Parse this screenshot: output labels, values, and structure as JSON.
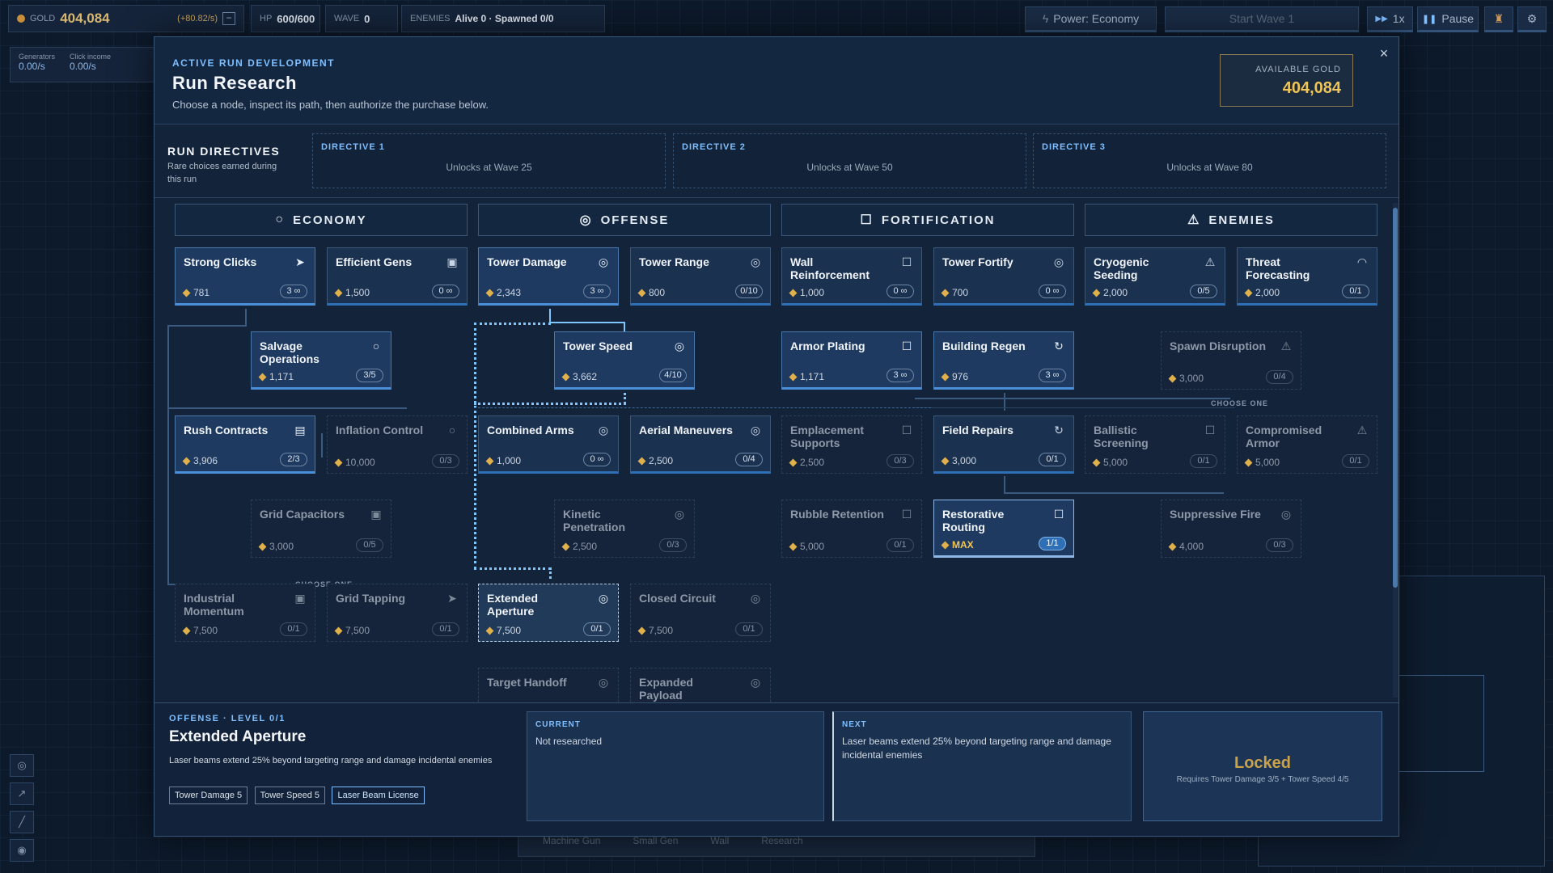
{
  "hud": {
    "gold_label": "GOLD",
    "gold_value": "404,084",
    "gold_rate": "(+80.82/s)",
    "hp_label": "HP",
    "hp_value": "600/600",
    "wave_label": "WAVE",
    "wave_value": "0",
    "enemies_label": "ENEMIES",
    "enemies_value": "Alive 0 · Spawned 0/0",
    "generators_label": "Generators",
    "generators_value": "0.00/s",
    "click_label": "Click income",
    "click_value": "0.00/s",
    "power_button": "Power: Economy",
    "start_wave_button": "Start Wave 1",
    "speed_button": "1x",
    "pause_button": "Pause"
  },
  "modal": {
    "kicker": "ACTIVE RUN DEVELOPMENT",
    "title": "Run Research",
    "subtitle": "Choose a node, inspect its path, then authorize the purchase below.",
    "available_gold_label": "AVAILABLE GOLD",
    "available_gold_value": "404,084",
    "close": "×",
    "directives_title": "RUN DIRECTIVES",
    "directives_sub": "Rare choices earned during this run",
    "directives": [
      {
        "title": "DIRECTIVE 1",
        "status": "Unlocks at Wave 25"
      },
      {
        "title": "DIRECTIVE 2",
        "status": "Unlocks at Wave 50"
      },
      {
        "title": "DIRECTIVE 3",
        "status": "Unlocks at Wave 80"
      }
    ],
    "columns": [
      {
        "label": "ECONOMY",
        "icon": "circle-icon"
      },
      {
        "label": "OFFENSE",
        "icon": "target-icon"
      },
      {
        "label": "FORTIFICATION",
        "icon": "square-icon"
      },
      {
        "label": "ENEMIES",
        "icon": "warning-icon"
      }
    ],
    "choose_one": "CHOOSE ONE"
  },
  "nodes": [
    {
      "id": "n1",
      "name": "Strong Clicks",
      "cost": "781",
      "level": "3 ∞",
      "icon": "cursor-icon",
      "glyph": "➤",
      "state": "on"
    },
    {
      "id": "n2",
      "name": "Efficient Gens",
      "cost": "1,500",
      "level": "0 ∞",
      "icon": "generator-icon",
      "glyph": "▣",
      "state": "norm"
    },
    {
      "id": "n3",
      "name": "Tower Damage",
      "cost": "2,343",
      "level": "3 ∞",
      "icon": "target-icon",
      "glyph": "◎",
      "state": "on"
    },
    {
      "id": "n4",
      "name": "Tower Range",
      "cost": "800",
      "level": "0/10",
      "icon": "target-icon",
      "glyph": "◎",
      "state": "norm"
    },
    {
      "id": "n5",
      "name": "Wall Reinforcement",
      "cost": "1,000",
      "level": "0 ∞",
      "icon": "square-icon",
      "glyph": "☐",
      "state": "norm"
    },
    {
      "id": "n6",
      "name": "Tower Fortify",
      "cost": "700",
      "level": "0 ∞",
      "icon": "target-icon",
      "glyph": "◎",
      "state": "norm"
    },
    {
      "id": "n7",
      "name": "Cryogenic Seeding",
      "cost": "2,000",
      "level": "0/5",
      "icon": "warning-icon",
      "glyph": "⚠",
      "state": "norm"
    },
    {
      "id": "n8",
      "name": "Threat Forecasting",
      "cost": "2,000",
      "level": "0/1",
      "icon": "radar-icon",
      "glyph": "◠",
      "state": "norm"
    },
    {
      "id": "n9",
      "name": "Salvage Operations",
      "cost": "1,171",
      "level": "3/5",
      "icon": "circle-icon",
      "glyph": "○",
      "state": "on"
    },
    {
      "id": "n10",
      "name": "Tower Speed",
      "cost": "3,662",
      "level": "4/10",
      "icon": "target-icon",
      "glyph": "◎",
      "state": "on"
    },
    {
      "id": "n11",
      "name": "Armor Plating",
      "cost": "1,171",
      "level": "3 ∞",
      "icon": "square-icon",
      "glyph": "☐",
      "state": "on"
    },
    {
      "id": "n12",
      "name": "Building Regen",
      "cost": "976",
      "level": "3 ∞",
      "icon": "regen-icon",
      "glyph": "↻",
      "state": "on"
    },
    {
      "id": "n13",
      "name": "Spawn Disruption",
      "cost": "3,000",
      "level": "0/4",
      "icon": "warning-icon",
      "glyph": "⚠",
      "state": "dim"
    },
    {
      "id": "n14",
      "name": "Rush Contracts",
      "cost": "3,906",
      "level": "2/3",
      "icon": "document-icon",
      "glyph": "▤",
      "state": "on"
    },
    {
      "id": "n15",
      "name": "Inflation Control",
      "cost": "10,000",
      "level": "0/3",
      "icon": "circle-icon",
      "glyph": "○",
      "state": "dim"
    },
    {
      "id": "n16",
      "name": "Combined Arms",
      "cost": "1,000",
      "level": "0 ∞",
      "icon": "target-icon",
      "glyph": "◎",
      "state": "norm"
    },
    {
      "id": "n17",
      "name": "Aerial Maneuvers",
      "cost": "2,500",
      "level": "0/4",
      "icon": "target-icon",
      "glyph": "◎",
      "state": "norm"
    },
    {
      "id": "n18",
      "name": "Emplacement Supports",
      "cost": "2,500",
      "level": "0/3",
      "icon": "square-icon",
      "glyph": "☐",
      "state": "dim"
    },
    {
      "id": "n19",
      "name": "Field Repairs",
      "cost": "3,000",
      "level": "0/1",
      "icon": "regen-icon",
      "glyph": "↻",
      "state": "norm"
    },
    {
      "id": "n20",
      "name": "Ballistic Screening",
      "cost": "5,000",
      "level": "0/1",
      "icon": "square-icon",
      "glyph": "☐",
      "state": "dim"
    },
    {
      "id": "n21",
      "name": "Compromised Armor",
      "cost": "5,000",
      "level": "0/1",
      "icon": "warning-icon",
      "glyph": "⚠",
      "state": "dim"
    },
    {
      "id": "n22",
      "name": "Grid Capacitors",
      "cost": "3,000",
      "level": "0/5",
      "icon": "generator-icon",
      "glyph": "▣",
      "state": "dim"
    },
    {
      "id": "n23",
      "name": "Kinetic Penetration",
      "cost": "2,500",
      "level": "0/3",
      "icon": "target-icon",
      "glyph": "◎",
      "state": "dim"
    },
    {
      "id": "n24",
      "name": "Rubble Retention",
      "cost": "5,000",
      "level": "0/1",
      "icon": "square-icon",
      "glyph": "☐",
      "state": "dim"
    },
    {
      "id": "n25",
      "name": "Restorative Routing",
      "cost": "MAX",
      "level": "1/1",
      "icon": "square-icon",
      "glyph": "☐",
      "state": "max"
    },
    {
      "id": "n26",
      "name": "Suppressive Fire",
      "cost": "4,000",
      "level": "0/3",
      "icon": "target-icon",
      "glyph": "◎",
      "state": "dim"
    },
    {
      "id": "n27",
      "name": "Industrial Momentum",
      "cost": "7,500",
      "level": "0/1",
      "icon": "generator-icon",
      "glyph": "▣",
      "state": "dim"
    },
    {
      "id": "n28",
      "name": "Grid Tapping",
      "cost": "7,500",
      "level": "0/1",
      "icon": "cursor-icon",
      "glyph": "➤",
      "state": "dim"
    },
    {
      "id": "n29",
      "name": "Extended Aperture",
      "cost": "7,500",
      "level": "0/1",
      "icon": "target-icon",
      "glyph": "◎",
      "state": "sel"
    },
    {
      "id": "n30",
      "name": "Closed Circuit",
      "cost": "7,500",
      "level": "0/1",
      "icon": "target-icon",
      "glyph": "◎",
      "state": "dim"
    },
    {
      "id": "n31",
      "name": "Target Handoff",
      "cost": "",
      "level": "",
      "icon": "target-icon",
      "glyph": "◎",
      "state": "dim"
    },
    {
      "id": "n32",
      "name": "Expanded Payload",
      "cost": "",
      "level": "",
      "icon": "target-icon",
      "glyph": "◎",
      "state": "dim"
    }
  ],
  "detail": {
    "kicker": "OFFENSE · LEVEL 0/1",
    "title": "Extended Aperture",
    "description": "Laser beams extend 25% beyond targeting range and damage incidental enemies",
    "tags": [
      "Tower Damage 5",
      "Tower Speed 5",
      "Laser Beam License"
    ],
    "current_label": "CURRENT",
    "current_text": "Not researched",
    "next_label": "NEXT",
    "next_text": "Laser beams extend 25% beyond targeting range and damage incidental enemies",
    "locked_label": "Locked",
    "locked_req": "Requires Tower Damage 3/5 + Tower Speed 4/5"
  },
  "bottom_bar": {
    "items": [
      "Machine Gun",
      "Small Gen",
      "Wall",
      "Research"
    ]
  },
  "colors": {
    "accent": "#7fbfff",
    "gold": "#e0b04a",
    "locked": "#c9a24a"
  }
}
